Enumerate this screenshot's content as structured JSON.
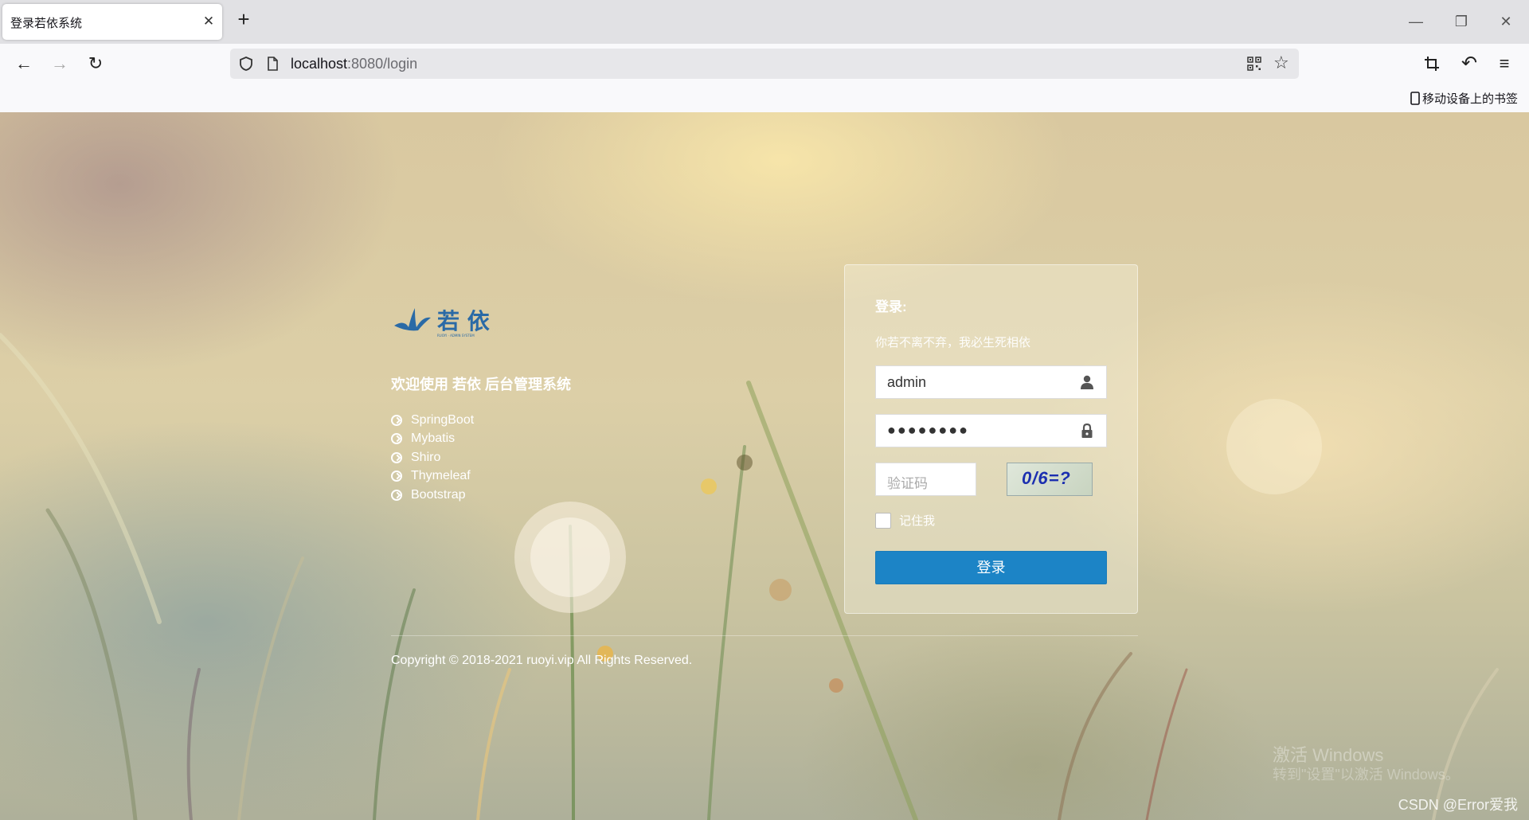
{
  "browser": {
    "tab_title": "登录若依系统",
    "url_host": "localhost",
    "url_rest": ":8080/login",
    "bookmark_label": "移动设备上的书签"
  },
  "page": {
    "welcome": "欢迎使用 若依 后台管理系统",
    "tech": [
      "SpringBoot",
      "Mybatis",
      "Shiro",
      "Thymeleaf",
      "Bootstrap"
    ],
    "login": {
      "title": "登录:",
      "subtitle": "你若不离不弃，我必生死相依",
      "username": "admin",
      "password_mask": "●●●●●●●●",
      "captcha_placeholder": "验证码",
      "captcha_code": "0/6=?",
      "remember_label": "记住我",
      "submit_label": "登录"
    },
    "copyright": "Copyright © 2018-2021 ruoyi.vip All Rights Reserved.",
    "watermark_line1": "激活 Windows",
    "watermark_line2": "转到\"设置\"以激活 Windows。",
    "csdn_mark": "CSDN @Error爱我"
  },
  "colors": {
    "primary": "#1c84c6",
    "logo": "#2a6aa6"
  }
}
